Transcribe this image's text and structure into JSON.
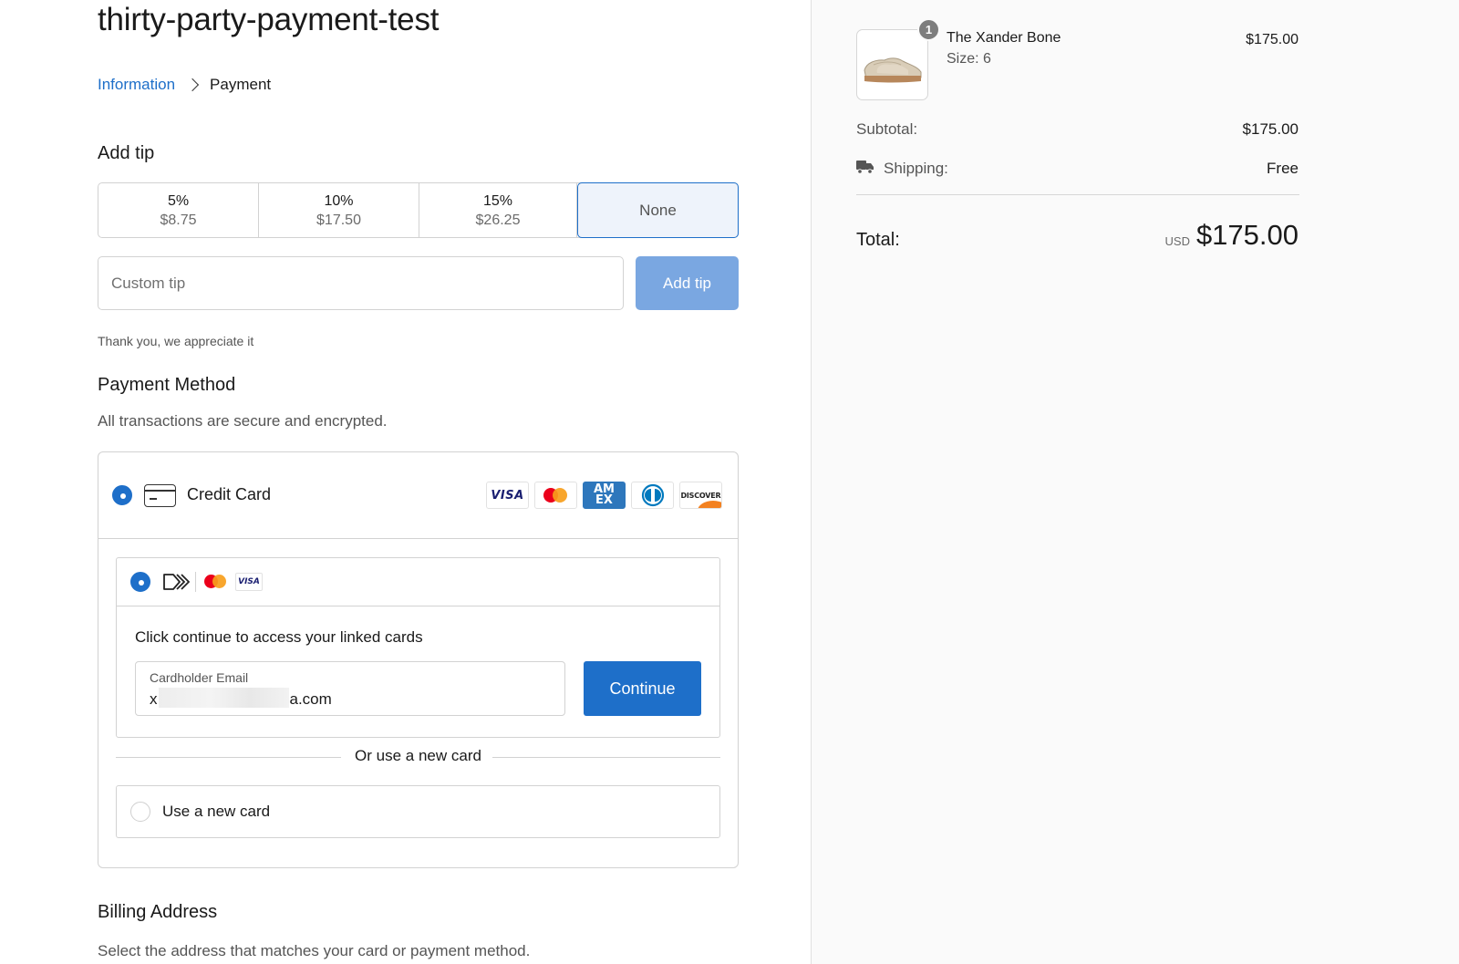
{
  "store": {
    "title": "thirty-party-payment-test"
  },
  "breadcrumb": {
    "items": [
      "Information",
      "Payment"
    ]
  },
  "tip": {
    "heading": "Add tip",
    "options": [
      {
        "percent": "5%",
        "amount": "$8.75"
      },
      {
        "percent": "10%",
        "amount": "$17.50"
      },
      {
        "percent": "15%",
        "amount": "$26.25"
      },
      {
        "percent": "None",
        "amount": ""
      }
    ],
    "selected_index": 3,
    "custom_placeholder": "Custom tip",
    "custom_value": "",
    "add_button": "Add tip",
    "thanks": "Thank you, we appreciate it"
  },
  "payment": {
    "heading": "Payment Method",
    "subtext": "All transactions are secure and encrypted.",
    "method_label": "Credit Card",
    "brand_logos": [
      "VISA",
      "mastercard",
      "AMEX",
      "diners",
      "DISCOVER"
    ],
    "linked": {
      "logos": [
        "click-to-pay",
        "mastercard",
        "VISA"
      ],
      "message": "Click continue to access your linked cards",
      "email_label": "Cardholder Email",
      "email_prefix": "x",
      "email_suffix": "a.com",
      "continue_button": "Continue"
    },
    "or_text": "Or use a new card",
    "new_card_label": "Use a new card"
  },
  "billing": {
    "heading": "Billing Address",
    "subtext": "Select the address that matches your card or payment method."
  },
  "summary": {
    "item": {
      "quantity": "1",
      "name": "The Xander Bone",
      "size": "Size: 6",
      "price": "$175.00"
    },
    "subtotal_label": "Subtotal:",
    "subtotal_value": "$175.00",
    "shipping_label": "Shipping:",
    "shipping_value": "Free",
    "total_label": "Total:",
    "currency": "USD",
    "total_value": "$175.00"
  },
  "colors": {
    "accent": "#1e6fc9",
    "button_disabled": "#7aa7e1",
    "sidebar_bg": "#fafafa"
  }
}
